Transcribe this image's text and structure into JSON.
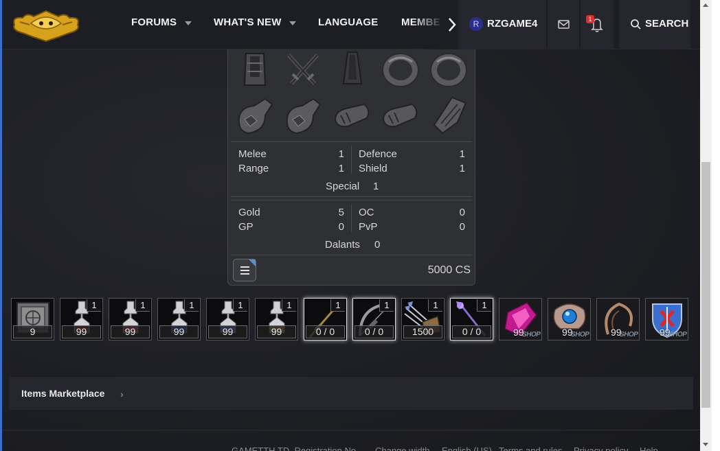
{
  "header": {
    "nav": [
      {
        "label": "FORUMS",
        "has_menu": true
      },
      {
        "label": "WHAT'S NEW",
        "has_menu": true
      },
      {
        "label": "LANGUAGE",
        "has_menu": false
      },
      {
        "label": "MEMBE",
        "has_menu": false
      }
    ],
    "avatar_letter": "R",
    "username": "RZGAME4",
    "alerts_badge": "1",
    "search_label": "SEARCH",
    "icons": [
      "logo",
      "chevron-right-icon",
      "envelope-icon",
      "bell-icon",
      "search-icon"
    ]
  },
  "equipment": {
    "stats_combat": [
      {
        "label": "Melee",
        "value": "1"
      },
      {
        "label": "Defence",
        "value": "1"
      },
      {
        "label": "Range",
        "value": "1"
      },
      {
        "label": "Shield",
        "value": "1"
      }
    ],
    "special": {
      "label": "Special",
      "value": "1"
    },
    "stats_currency": [
      {
        "label": "Gold",
        "value": "5"
      },
      {
        "label": "OC",
        "value": "0"
      },
      {
        "label": "GP",
        "value": "0"
      },
      {
        "label": "PvP",
        "value": "0"
      }
    ],
    "dalants": {
      "label": "Dalants",
      "value": "0"
    },
    "cs": "5000 CS"
  },
  "inventory": {
    "items": [
      {
        "kind": "box",
        "count": "9"
      },
      {
        "kind": "potion-red",
        "count": "99",
        "qty": "1"
      },
      {
        "kind": "potion-red",
        "count": "99",
        "qty": "1"
      },
      {
        "kind": "potion-blue",
        "count": "99",
        "qty": "1"
      },
      {
        "kind": "potion-blue",
        "count": "99",
        "qty": "1"
      },
      {
        "kind": "potion-gold",
        "count": "99",
        "qty": "1"
      },
      {
        "kind": "spear",
        "count": "0 / 0",
        "qty": "1"
      },
      {
        "kind": "bow",
        "count": "0 / 0",
        "qty": "1"
      },
      {
        "kind": "arrows",
        "count": "1500",
        "qty": "1"
      },
      {
        "kind": "staff",
        "count": "0 / 0",
        "qty": "1"
      },
      {
        "kind": "shop-gem",
        "count": "99",
        "shop": "SHOP"
      },
      {
        "kind": "shop-orb",
        "count": "99",
        "shop": "SHOP"
      },
      {
        "kind": "shop-bow",
        "count": "99",
        "shop": "SHOP"
      },
      {
        "kind": "shop-shield",
        "count": "99",
        "shop": "SHOP"
      }
    ]
  },
  "breadcrumb": {
    "label": "Items Marketplace"
  },
  "footer": {
    "left": "GAMETTH TD, Registration No. ...",
    "links": [
      "Change width",
      "English (US)",
      "Terms and rules",
      "Privacy policy",
      "Help"
    ]
  }
}
